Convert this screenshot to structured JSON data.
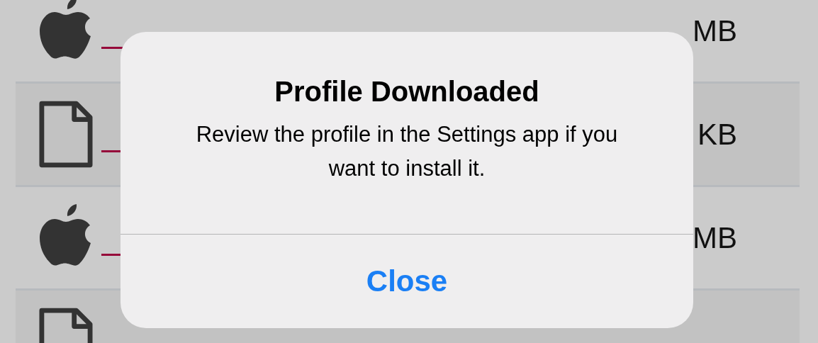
{
  "files": [
    {
      "kind": "app",
      "underlined": true,
      "size": "MB"
    },
    {
      "kind": "document",
      "underlined": true,
      "size": "KB"
    },
    {
      "kind": "app",
      "underlined": true,
      "size": "MB"
    },
    {
      "kind": "document",
      "underlined": false
    }
  ],
  "alert": {
    "title": "Profile Downloaded",
    "message": "Review the profile in the Settings app if you want to install it.",
    "button": "Close"
  }
}
